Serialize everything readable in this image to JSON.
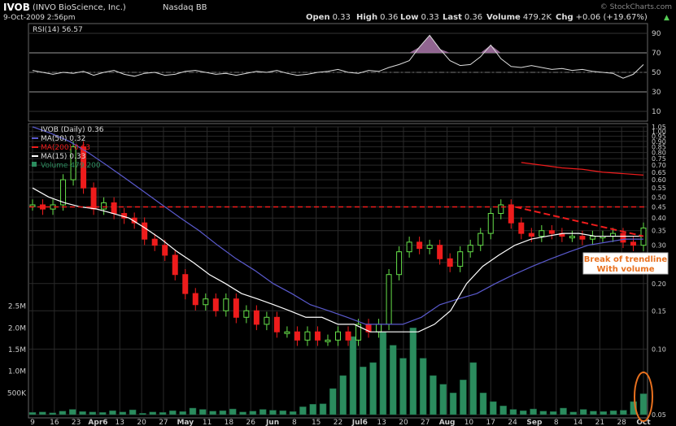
{
  "header": {
    "symbol": "IVOB",
    "company": "(INVO BioScience, Inc.)",
    "exchange": "Nasdaq BB",
    "date": "9-Oct-2009 2:56pm",
    "watermark": "© StockCharts.com",
    "open_label": "Open",
    "open": "0.33",
    "high_label": "High",
    "high": "0.36",
    "low_label": "Low",
    "low": "0.33",
    "last_label": "Last",
    "last": "0.36",
    "volume_label": "Volume",
    "volume": "479.2K",
    "chg_label": "Chg",
    "chg": "+0.06 (+19.67%)",
    "chg_arrow": "▲"
  },
  "legend": {
    "rsi": "RSI(14) 56.57",
    "main": "IVOB (Daily) 0.36",
    "ma50": "MA(50) 0.32",
    "ma200": "MA(200) 0.63",
    "ma15": "MA(15) 0.33",
    "volume": "Volume 479,200"
  },
  "annotation": {
    "line1": "Break of trendline",
    "line2": "With volume"
  },
  "colors": {
    "background": "#000000",
    "up": "#66e04a",
    "down": "#ee1c1c",
    "ma50": "#5a5acd",
    "ma200": "#ee1c1c",
    "ma15": "#ffffff",
    "volume": "#2b8c5e",
    "rsi_fill": "#a070a0",
    "annotation": "#e8701e",
    "grid": "#333333"
  },
  "chart_data": [
    {
      "type": "line",
      "title": "RSI(14) 56.57",
      "ylim": [
        0,
        100
      ],
      "yticks": [
        10,
        30,
        50,
        70,
        90
      ],
      "reference_levels": [
        30,
        70
      ],
      "series": [
        {
          "name": "RSI(14)",
          "values": [
            52,
            50,
            48,
            50,
            49,
            51,
            47,
            50,
            52,
            48,
            46,
            49,
            50,
            47,
            48,
            51,
            52,
            50,
            48,
            49,
            47,
            49,
            51,
            50,
            52,
            49,
            47,
            48,
            50,
            51,
            53,
            50,
            49,
            52,
            51,
            55,
            58,
            62,
            76,
            88,
            74,
            62,
            57,
            58,
            66,
            78,
            64,
            56,
            55,
            57,
            55,
            53,
            54,
            52,
            53,
            51,
            50,
            49,
            44,
            48,
            58
          ]
        }
      ]
    },
    {
      "type": "line",
      "title": "IVOB (Daily) 0.36",
      "x": [
        "9",
        "16",
        "23",
        "Apr6",
        "13",
        "20",
        "27",
        "May",
        "11",
        "18",
        "26",
        "Jun",
        "8",
        "15",
        "22",
        "Jul6",
        "13",
        "20",
        "27",
        "Aug",
        "10",
        "17",
        "24",
        "Sep",
        "8",
        "14",
        "21",
        "28",
        "Oct"
      ],
      "ylim": [
        0.05,
        1.05
      ],
      "yscale": "log",
      "yticks": [
        0.05,
        0.1,
        0.15,
        0.2,
        0.25,
        0.3,
        0.35,
        0.4,
        0.45,
        0.5,
        0.55,
        0.6,
        0.65,
        0.7,
        0.75,
        0.8,
        0.85,
        0.9,
        0.95,
        1.0,
        1.05
      ],
      "series": [
        {
          "name": "IVOB (Daily)",
          "values": [
            0.46,
            0.44,
            0.46,
            0.6,
            0.85,
            0.55,
            0.44,
            0.47,
            0.42,
            0.4,
            0.38,
            0.32,
            0.3,
            0.27,
            0.22,
            0.18,
            0.16,
            0.17,
            0.15,
            0.17,
            0.14,
            0.15,
            0.13,
            0.14,
            0.12,
            0.12,
            0.11,
            0.12,
            0.11,
            0.11,
            0.12,
            0.11,
            0.13,
            0.12,
            0.13,
            0.22,
            0.28,
            0.31,
            0.29,
            0.3,
            0.26,
            0.24,
            0.28,
            0.3,
            0.34,
            0.42,
            0.46,
            0.38,
            0.34,
            0.33,
            0.35,
            0.34,
            0.33,
            0.33,
            0.32,
            0.33,
            0.33,
            0.34,
            0.31,
            0.3,
            0.36
          ]
        },
        {
          "name": "MA(50)",
          "values": [
            1.05,
            0.98,
            0.9,
            0.8,
            0.7,
            0.61,
            0.53,
            0.46,
            0.4,
            0.35,
            0.3,
            0.26,
            0.23,
            0.2,
            0.18,
            0.16,
            0.15,
            0.14,
            0.13,
            0.13,
            0.13,
            0.14,
            0.16,
            0.17,
            0.18,
            0.2,
            0.22,
            0.24,
            0.26,
            0.28,
            0.3,
            0.31,
            0.32,
            0.32
          ]
        },
        {
          "name": "MA(200)",
          "values": [
            0.72,
            0.7,
            0.68,
            0.67,
            0.65,
            0.64,
            0.63
          ]
        },
        {
          "name": "MA(15)",
          "values": [
            0.55,
            0.5,
            0.47,
            0.45,
            0.44,
            0.42,
            0.4,
            0.36,
            0.32,
            0.28,
            0.25,
            0.22,
            0.2,
            0.18,
            0.17,
            0.16,
            0.15,
            0.14,
            0.14,
            0.13,
            0.13,
            0.12,
            0.12,
            0.12,
            0.12,
            0.13,
            0.15,
            0.2,
            0.24,
            0.27,
            0.3,
            0.32,
            0.33,
            0.34,
            0.34,
            0.33,
            0.33,
            0.33,
            0.33
          ]
        }
      ],
      "resistance_level": 0.45,
      "trendline": [
        0.45,
        0.33
      ]
    },
    {
      "type": "bar",
      "title": "Volume 479,200",
      "yticks": [
        "500K",
        "1.0M",
        "1.5M",
        "2.0M",
        "2.5M"
      ],
      "ylim": [
        0,
        3000000
      ],
      "series": [
        {
          "name": "Volume",
          "values": [
            50000,
            60000,
            40000,
            80000,
            120000,
            70000,
            60000,
            50000,
            90000,
            60000,
            110000,
            30000,
            60000,
            50000,
            90000,
            70000,
            150000,
            120000,
            80000,
            90000,
            130000,
            60000,
            80000,
            120000,
            100000,
            90000,
            70000,
            180000,
            240000,
            250000,
            600000,
            900000,
            1800000,
            1100000,
            1200000,
            1900000,
            1600000,
            1300000,
            2000000,
            1300000,
            900000,
            700000,
            500000,
            800000,
            1200000,
            500000,
            300000,
            200000,
            120000,
            90000,
            130000,
            80000,
            70000,
            150000,
            60000,
            120000,
            80000,
            70000,
            90000,
            100000,
            300000,
            480000
          ]
        }
      ]
    }
  ]
}
